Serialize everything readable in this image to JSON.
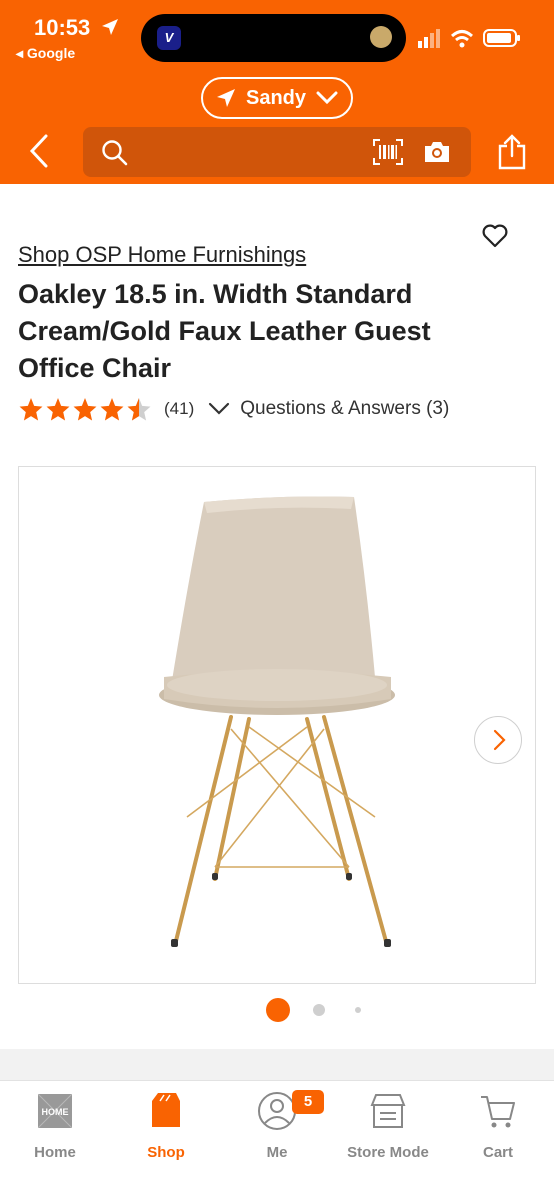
{
  "status_bar": {
    "time": "10:53",
    "back_app": "◂ Google"
  },
  "header": {
    "store_name": "Sandy",
    "search_placeholder": "",
    "accent": "#f96302"
  },
  "product": {
    "brand_link": "Shop OSP Home Furnishings",
    "title": "Oakley 18.5 in. Width Standard Cream/Gold Faux Leather Guest Office Chair",
    "rating": 4.5,
    "review_count": "(41)",
    "qa_label": "Questions & Answers (3)",
    "image_count": 3,
    "active_image": 1
  },
  "tabs": [
    {
      "label": "Home",
      "icon": "home-depot-logo-icon",
      "active": false
    },
    {
      "label": "Shop",
      "icon": "shop-bag-icon",
      "active": true
    },
    {
      "label": "Me",
      "icon": "person-icon",
      "active": false,
      "badge": "5"
    },
    {
      "label": "Store Mode",
      "icon": "store-icon",
      "active": false
    },
    {
      "label": "Cart",
      "icon": "cart-icon",
      "active": false
    }
  ]
}
